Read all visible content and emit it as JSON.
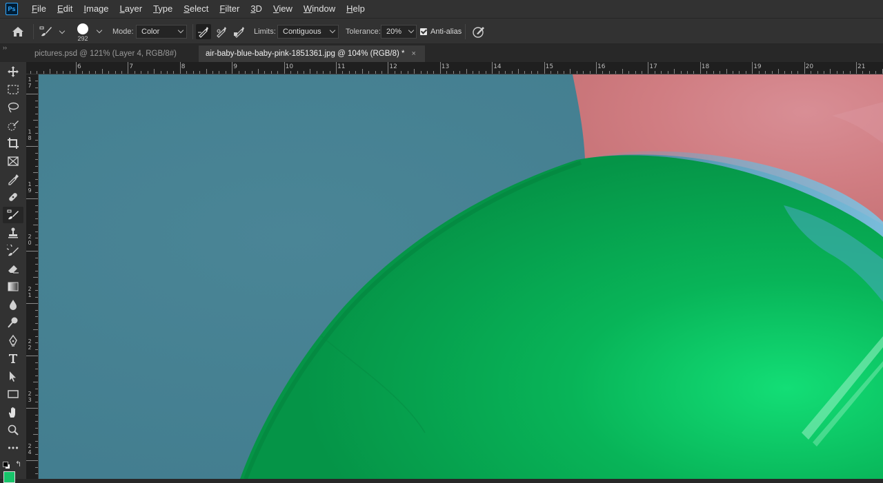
{
  "app": {
    "logo_text": "Ps"
  },
  "menu": [
    "File",
    "Edit",
    "Image",
    "Layer",
    "Type",
    "Select",
    "Filter",
    "3D",
    "View",
    "Window",
    "Help"
  ],
  "options": {
    "brush_size": "292",
    "mode_label": "Mode:",
    "mode_value": "Color",
    "limits_label": "Limits:",
    "limits_value": "Contiguous",
    "tolerance_label": "Tolerance:",
    "tolerance_value": "20%",
    "antialias_label": "Anti-alias",
    "antialias_checked": true
  },
  "tabs": [
    {
      "title": "pictures.psd @ 121% (Layer 4, RGB/8#) *",
      "active": false,
      "close": "×"
    },
    {
      "title": "air-baby-blue-baby-pink-1851361.jpg @ 104% (RGB/8) *",
      "active": true,
      "close": "×"
    }
  ],
  "ruler": {
    "top_labels": [
      "6",
      "7",
      "8",
      "9",
      "10",
      "11",
      "12",
      "13",
      "14",
      "15",
      "16",
      "17",
      "18",
      "19",
      "20",
      "21"
    ],
    "left_labels": [
      "17",
      "18",
      "19",
      "20",
      "21",
      "22",
      "23",
      "24"
    ]
  },
  "tools": [
    "move-tool-icon",
    "marquee-tool-icon",
    "lasso-tool-icon",
    "quick-selection-tool-icon",
    "crop-tool-icon",
    "frame-tool-icon",
    "eyedropper-tool-icon",
    "healing-brush-tool-icon",
    "color-replacement-tool-icon",
    "clone-stamp-tool-icon",
    "history-brush-tool-icon",
    "eraser-tool-icon",
    "gradient-tool-icon",
    "blur-tool-icon",
    "dodge-tool-icon",
    "pen-tool-icon",
    "type-tool-icon",
    "path-selection-tool-icon",
    "rectangle-tool-icon",
    "hand-tool-icon",
    "zoom-tool-icon",
    "edit-toolbar-icon"
  ],
  "colors": {
    "canvas_background": "#4a8596",
    "balloon_green": "#06a84c",
    "balloon_pink": "#d4868a",
    "foreground_swatch": "#17c46a"
  }
}
